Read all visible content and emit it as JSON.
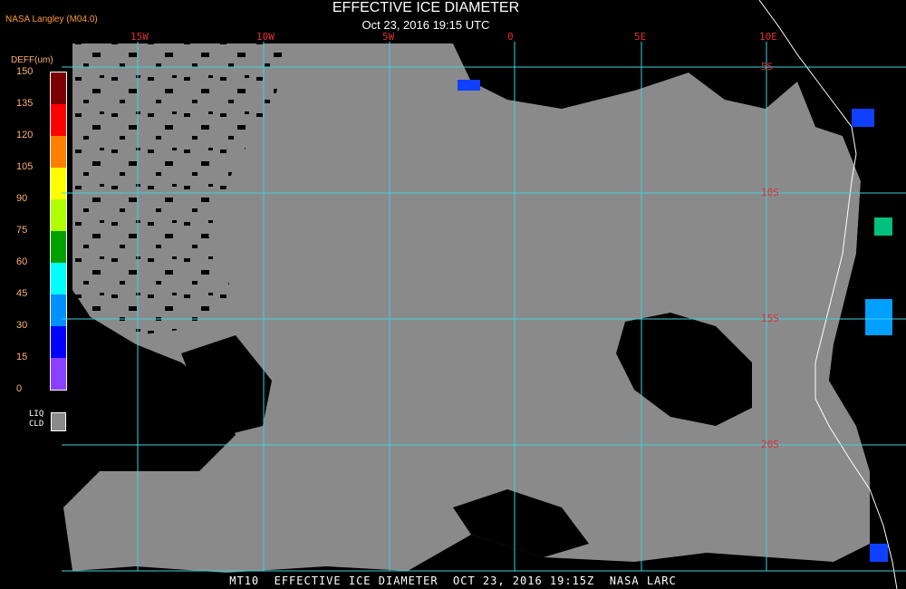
{
  "header": {
    "title": "EFFECTIVE ICE DIAMETER",
    "subtitle": "Oct 23, 2016 19:15 UTC",
    "producer": "NASA Langley (M04.0)"
  },
  "legend": {
    "title": "DEFF(um)",
    "ticks": [
      "150",
      "135",
      "120",
      "105",
      "90",
      "75",
      "60",
      "45",
      "30",
      "15",
      "0"
    ],
    "colors": [
      "#7a0000",
      "#ff0000",
      "#ff8000",
      "#ffff00",
      "#b0ff00",
      "#00a000",
      "#00ffff",
      "#0090ff",
      "#0000ff",
      "#8a40ff"
    ],
    "liquid_label": "LIQ\nCLD",
    "liquid_color": "#8a8a8a"
  },
  "map": {
    "lon_labels": [
      "15W",
      "10W",
      "5W",
      "0",
      "5E",
      "10E"
    ],
    "lat_labels": [
      "5S",
      "10S",
      "15S",
      "20S"
    ],
    "grid_color": "#40d0e0",
    "cloud_color": "#8a8a8a",
    "coast_color": "#ffffff"
  },
  "footer": {
    "text": "MT10  EFFECTIVE ICE DIAMETER  OCT 23, 2016 19:15Z  NASA LARC"
  }
}
